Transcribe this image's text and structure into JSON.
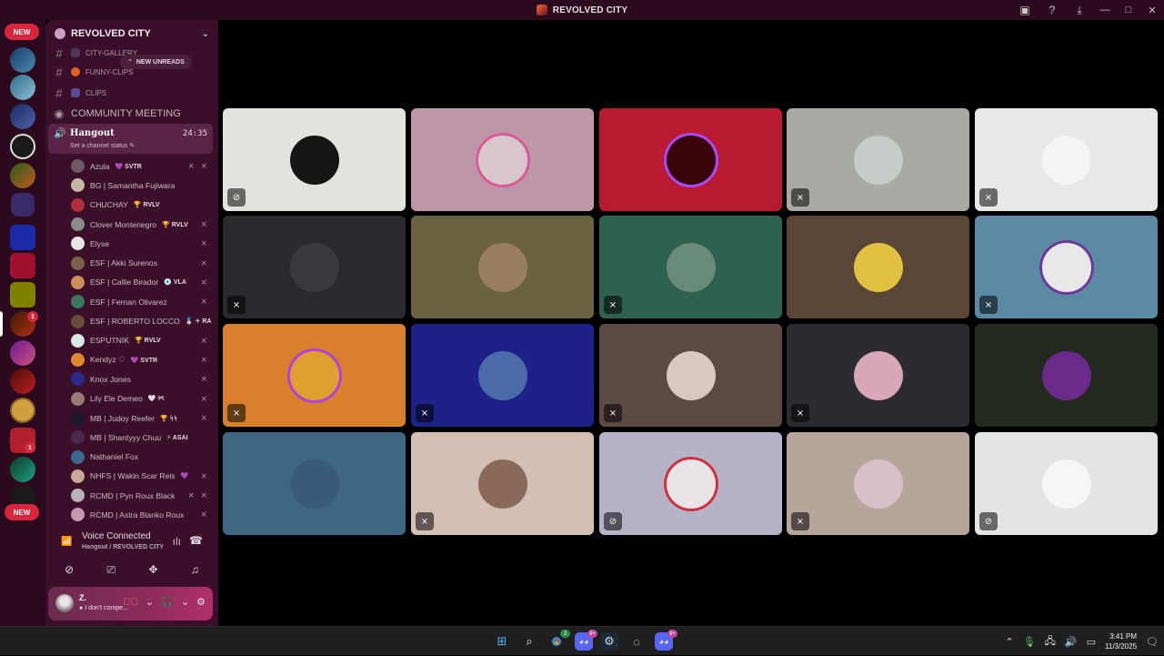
{
  "window": {
    "title": "REVOLVED CITY"
  },
  "rail": {
    "new_label_top": "NEW",
    "new_label_bottom": "NEW",
    "badge_a": "1",
    "badge_b": "1"
  },
  "server": {
    "name": "REVOLVED CITY"
  },
  "channels": {
    "gallery": "CITY-GALLERY",
    "funny": "FUNNY-CLIPS",
    "clips": "CLIPS",
    "new_unreads": "NEW UNREADS",
    "stage": "COMMUNITY MEETING"
  },
  "voice_channel": {
    "name": "Hangout",
    "time": "24:35",
    "status": "Set a channel status"
  },
  "members": [
    {
      "name": "Azula",
      "tag": "💜 SVTR",
      "color": "#6d5a66",
      "muted": true,
      "deaf": true
    },
    {
      "name": "BG | Samantha Fujiwara",
      "tag": "",
      "color": "#c8b6a6",
      "muted": false,
      "deaf": false
    },
    {
      "name": "CHUCHAY",
      "tag": "🏆 RVLV",
      "color": "#b0303a",
      "muted": false,
      "deaf": false
    },
    {
      "name": "Clover Montenegro",
      "tag": "🏆 RVLV",
      "color": "#8a8a8a",
      "muted": true,
      "deaf": false
    },
    {
      "name": "Elyse",
      "tag": "",
      "color": "#e5e5e5",
      "muted": true,
      "deaf": false
    },
    {
      "name": "ESF | Akki Surenos",
      "tag": "",
      "color": "#7a6048",
      "muted": true,
      "deaf": false
    },
    {
      "name": "ESF | Callie Birador",
      "tag": "💿 VLA",
      "color": "#c9905a",
      "muted": true,
      "deaf": false
    },
    {
      "name": "ESF | Fernan Olivarez",
      "tag": "",
      "color": "#3a7a5a",
      "muted": true,
      "deaf": false
    },
    {
      "name": "ESF | ROBERTO LOCCO",
      "tag": "🥈 ✈ RA",
      "color": "#6a4a3a",
      "muted": false,
      "deaf": false
    },
    {
      "name": "ESPUTNIK",
      "tag": "🏆 RVLV",
      "color": "#d8e8e6",
      "muted": true,
      "deaf": false
    },
    {
      "name": "Kendyz ♡",
      "tag": "💜 SVTR",
      "color": "#e08830",
      "muted": true,
      "deaf": false
    },
    {
      "name": "Knox Jones",
      "tag": "",
      "color": "#2a2a8a",
      "muted": true,
      "deaf": false
    },
    {
      "name": "Lily Ele Demeo",
      "tag": "🤍 ୨ৎ",
      "color": "#9a7a74",
      "muted": true,
      "deaf": false
    },
    {
      "name": "MB | Judoy Reefer",
      "tag": "🏆 ᛋᛋ",
      "color": "#1a1a2a",
      "muted": true,
      "deaf": false
    },
    {
      "name": "MB | Shantyyy Chuu",
      "tag": "⚡ ASAI",
      "color": "#4a2a4a",
      "muted": false,
      "deaf": false
    },
    {
      "name": "Nathaniel Fox",
      "tag": "",
      "color": "#3a6a8a",
      "muted": false,
      "deaf": false
    },
    {
      "name": "NHFS | Wakin Scar Reis",
      "tag": "💜",
      "color": "#c8a898",
      "muted": true,
      "deaf": false
    },
    {
      "name": "RCMD | Pyn Roux Black",
      "tag": "",
      "color": "#b8b0bc",
      "muted": true,
      "deaf": true
    },
    {
      "name": "RCMD | Astra Blanko Roux",
      "tag": "",
      "color": "#c898b0",
      "muted": true,
      "deaf": false
    }
  ],
  "voice_panel": {
    "status": "Voice Connected",
    "location": "Hangout / REVOLVED CITY"
  },
  "user": {
    "name": "Z.",
    "status": "I don't compe..."
  },
  "tiles": [
    {
      "bg": "#e2e2df",
      "face": "#151515",
      "ring": "",
      "icon": "deaf"
    },
    {
      "bg": "#bf96a8",
      "face": "#d8c8cc",
      "ring": "#d85a9a",
      "icon": ""
    },
    {
      "bg": "#b81a32",
      "face": "#3a0508",
      "ring": "#a64bff",
      "icon": ""
    },
    {
      "bg": "#a8aaa3",
      "face": "#c8ccc8",
      "ring": "",
      "icon": "mute"
    },
    {
      "bg": "#e8e8e8",
      "face": "#f4f4f4",
      "ring": "",
      "icon": "mute"
    },
    {
      "bg": "#2a2a2e",
      "face": "#3a3a3e",
      "ring": "",
      "icon": "mute"
    },
    {
      "bg": "#6a6242",
      "face": "#9a7e62",
      "ring": "",
      "icon": ""
    },
    {
      "bg": "#2f6150",
      "face": "#6a8a7a",
      "ring": "",
      "icon": "mute"
    },
    {
      "bg": "#5a4636",
      "face": "#e0c040",
      "ring": "",
      "icon": ""
    },
    {
      "bg": "#5c8aa4",
      "face": "#e8e8e8",
      "ring": "#6a3a9a",
      "icon": "mute"
    },
    {
      "bg": "#d9802c",
      "face": "#e0a030",
      "ring": "#b040e0",
      "icon": "mute"
    },
    {
      "bg": "#1e2288",
      "face": "#4a6aaa",
      "ring": "",
      "icon": "mute"
    },
    {
      "bg": "#5c4b44",
      "face": "#d8c8c0",
      "ring": "",
      "icon": "mute"
    },
    {
      "bg": "#2c2b32",
      "face": "#d8a8b8",
      "ring": "",
      "icon": "mute"
    },
    {
      "bg": "#24291f",
      "face": "#6a2a8a",
      "ring": "",
      "icon": ""
    },
    {
      "bg": "#3f6784",
      "face": "#3a5a7a",
      "ring": "",
      "icon": ""
    },
    {
      "bg": "#d4bfb4",
      "face": "#8a6a5a",
      "ring": "",
      "icon": "mute"
    },
    {
      "bg": "#b5b4c6",
      "face": "#e8e4e8",
      "ring": "#d03040",
      "icon": "deaf"
    },
    {
      "bg": "#b7a59b",
      "face": "#d8c0c8",
      "ring": "",
      "icon": "mute"
    },
    {
      "bg": "#e4e4e4",
      "face": "#f6f6f6",
      "ring": "",
      "icon": "deaf"
    }
  ],
  "taskbar": {
    "discord_badge_1": "9+",
    "discord_badge_2": "9+",
    "chrome_badge": "2"
  },
  "clock": {
    "time": "3:41 PM",
    "date": "11/3/2025"
  }
}
